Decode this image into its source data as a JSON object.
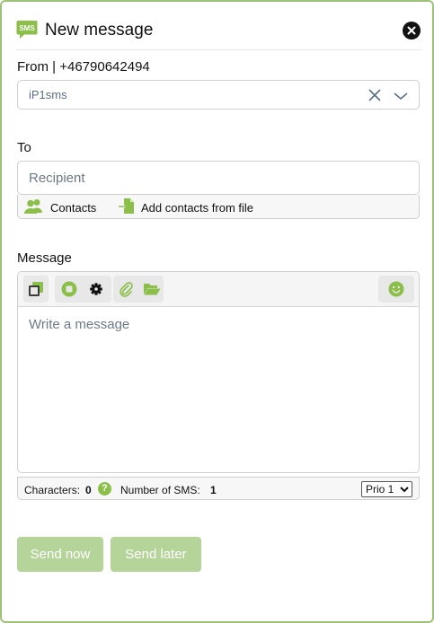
{
  "header": {
    "title": "New message",
    "logo_text": "SMS",
    "logo_icon": "sms-logo-icon",
    "close_icon": "close-icon"
  },
  "from": {
    "label": "From | +46790642494",
    "selected": "iP1sms",
    "clear_icon": "clear-icon",
    "dropdown_icon": "chevron-down-icon"
  },
  "to": {
    "label": "To",
    "placeholder": "Recipient",
    "contacts_label": "Contacts",
    "add_from_file_label": "Add contacts from file"
  },
  "message": {
    "label": "Message",
    "placeholder": "Write a message",
    "toolbar_icons": [
      "copy-icon",
      "stop-icon",
      "settings-icon",
      "paperclip-icon",
      "folder-open-icon",
      "emoji-icon"
    ]
  },
  "footer": {
    "characters_label": "Characters:",
    "characters_value": "0",
    "sms_count_label": "Number of SMS:",
    "sms_count_value": "1",
    "priority_selected": "Prio 1"
  },
  "actions": {
    "send_now": "Send now",
    "send_later": "Send later"
  },
  "colors": {
    "accent": "#8bbf4a",
    "button_disabled": "#b5d499",
    "border": "#9fc27a"
  }
}
